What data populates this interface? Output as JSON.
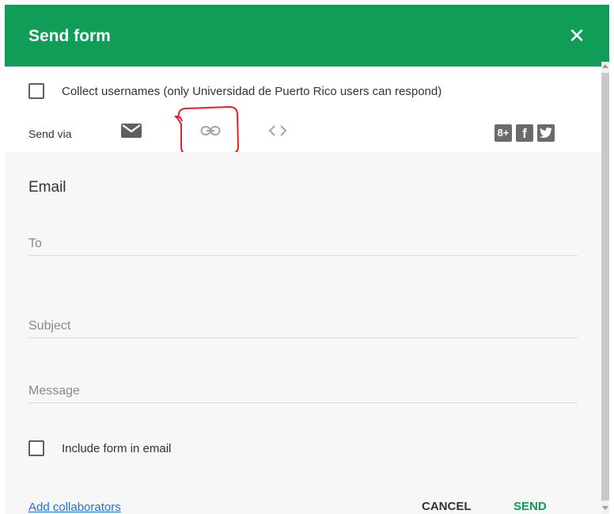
{
  "dialog": {
    "title": "Send form",
    "close_icon": "close-icon"
  },
  "collect": {
    "label": "Collect usernames (only Universidad de Puerto Rico users can respond)",
    "checked": false
  },
  "send_via": {
    "label": "Send via",
    "tabs": [
      {
        "name": "email",
        "icon": "envelope-icon",
        "selected": true
      },
      {
        "name": "link",
        "icon": "link-icon",
        "selected": false
      },
      {
        "name": "embed",
        "icon": "embed-code-icon",
        "selected": false
      }
    ],
    "social": [
      {
        "icon": "google-plus-icon",
        "glyph": "8+"
      },
      {
        "icon": "facebook-icon",
        "glyph": "f"
      },
      {
        "icon": "twitter-icon"
      }
    ]
  },
  "email": {
    "section_title": "Email",
    "to_placeholder": "To",
    "subject_placeholder": "Subject",
    "message_placeholder": "Message",
    "include_label": "Include form in email",
    "include_checked": false
  },
  "footer": {
    "add_collaborators": "Add collaborators",
    "cancel": "CANCEL",
    "send": "SEND"
  },
  "colors": {
    "accent": "#0f9d58",
    "link": "#1a73e8",
    "annotation": "#e8202a"
  }
}
